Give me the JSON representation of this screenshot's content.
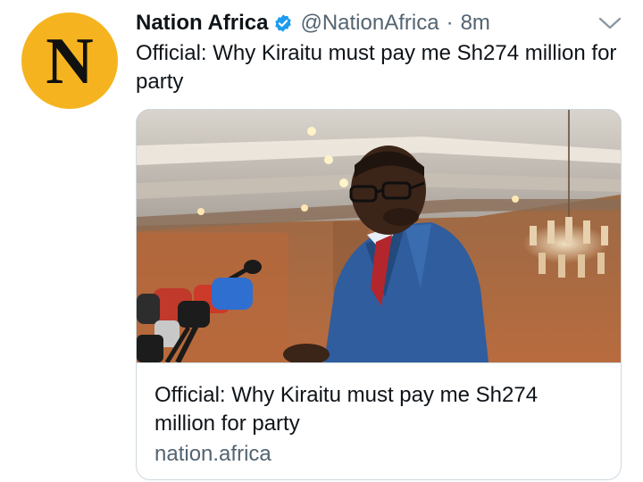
{
  "tweet": {
    "avatar_letter": "N",
    "display_name": "Nation Africa",
    "handle": "@NationAfrica",
    "separator": "·",
    "timestamp": "8m",
    "text": "Official: Why Kiraitu must pay me Sh274 million for party"
  },
  "card": {
    "title": "Official: Why Kiraitu must pay me Sh274 million for party",
    "domain": "nation.africa"
  },
  "icons": {
    "verified": "verified-badge-icon",
    "more": "chevron-down-icon"
  },
  "colors": {
    "avatar_bg": "#f5b41f",
    "verified": "#1d9bf0",
    "secondary_text": "#536471",
    "border": "#cfd9de"
  }
}
